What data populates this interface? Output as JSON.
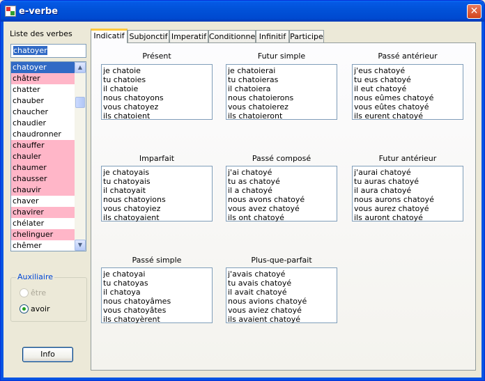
{
  "window": {
    "title": "e-verbe",
    "close_glyph": "✕"
  },
  "left": {
    "list_label": "Liste des verbes",
    "input_value": "chatoyer",
    "verbs": [
      {
        "label": "chatoyer",
        "state": "selected"
      },
      {
        "label": "châtrer",
        "state": "pink"
      },
      {
        "label": "chatter",
        "state": "plain"
      },
      {
        "label": "chauber",
        "state": "plain"
      },
      {
        "label": "chaucher",
        "state": "plain"
      },
      {
        "label": "chaudier",
        "state": "plain"
      },
      {
        "label": "chaudronner",
        "state": "plain"
      },
      {
        "label": "chauffer",
        "state": "pink"
      },
      {
        "label": "chauler",
        "state": "pink"
      },
      {
        "label": "chaumer",
        "state": "pink"
      },
      {
        "label": "chausser",
        "state": "pink"
      },
      {
        "label": "chauvir",
        "state": "pink"
      },
      {
        "label": "chaver",
        "state": "plain"
      },
      {
        "label": "chavirer",
        "state": "pink"
      },
      {
        "label": "chélater",
        "state": "plain"
      },
      {
        "label": "chelinguer",
        "state": "pink"
      },
      {
        "label": "chêmer",
        "state": "plain"
      }
    ],
    "scroll_up": "▲",
    "scroll_down": "▼",
    "auxiliaire": {
      "title": "Auxiliaire",
      "options": [
        {
          "label": "être",
          "checked": false,
          "disabled": true
        },
        {
          "label": "avoir",
          "checked": true,
          "disabled": false
        }
      ]
    },
    "info_button": "Info"
  },
  "tabs": [
    {
      "label": "Indicatif",
      "active": true
    },
    {
      "label": "Subjonctif",
      "active": false
    },
    {
      "label": "Imperatif",
      "active": false
    },
    {
      "label": "Conditionnel",
      "active": false
    },
    {
      "label": "Infinitif",
      "active": false
    },
    {
      "label": "Participe",
      "active": false
    }
  ],
  "tenses": [
    {
      "title": "Présent",
      "lines": [
        "je chatoie",
        "tu chatoies",
        "il chatoie",
        "nous chatoyons",
        "vous chatoyez",
        "ils chatoient"
      ]
    },
    {
      "title": "Futur simple",
      "lines": [
        "je chatoierai",
        "tu chatoieras",
        "il chatoiera",
        "nous chatoierons",
        "vous chatoierez",
        "ils chatoieront"
      ]
    },
    {
      "title": "Passé antérieur",
      "lines": [
        "j'eus chatoyé",
        "tu eus chatoyé",
        "il eut chatoyé",
        "nous eûmes chatoyé",
        "vous eûtes chatoyé",
        "ils eurent chatoyé"
      ]
    },
    {
      "title": "Imparfait",
      "lines": [
        "je chatoyais",
        "tu chatoyais",
        "il chatoyait",
        "nous chatoyions",
        "vous chatoyiez",
        "ils chatoyaient"
      ]
    },
    {
      "title": "Passé composé",
      "lines": [
        "j'ai chatoyé",
        "tu as chatoyé",
        "il a chatoyé",
        "nous avons chatoyé",
        "vous avez chatoyé",
        "ils ont chatoyé"
      ]
    },
    {
      "title": "Futur antérieur",
      "lines": [
        "j'aurai chatoyé",
        "tu auras chatoyé",
        "il aura chatoyé",
        "nous aurons chatoyé",
        "vous aurez chatoyé",
        "ils auront chatoyé"
      ]
    },
    {
      "title": "Passé simple",
      "lines": [
        "je chatoyai",
        "tu chatoyas",
        "il chatoya",
        "nous chatoyâmes",
        "vous chatoyâtes",
        "ils chatoyèrent"
      ]
    },
    {
      "title": "Plus-que-parfait",
      "lines": [
        "j'avais chatoyé",
        "tu avais chatoyé",
        "il avait chatoyé",
        "nous avions chatoyé",
        "vous aviez chatoyé",
        "ils avaient chatoyé"
      ]
    }
  ],
  "colors": {
    "highlight_pink": "#ffb6c8",
    "selection_blue": "#316ac5",
    "titlebar_blue": "#0152d9",
    "active_tab_accent": "#ffc83c"
  }
}
